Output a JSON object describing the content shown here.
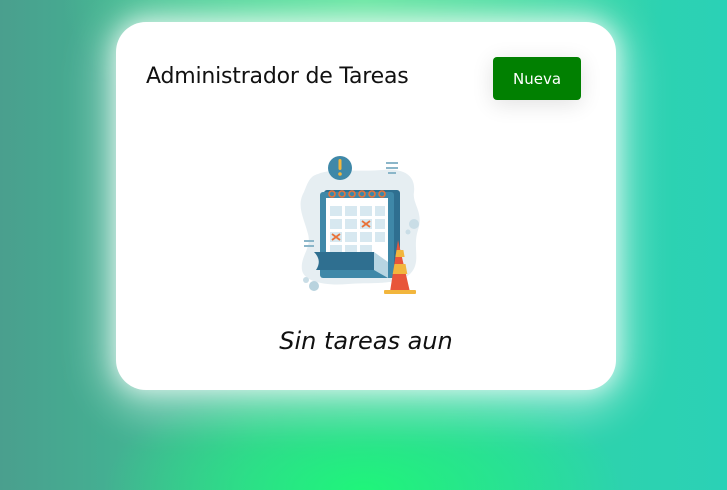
{
  "app": {
    "title": "Administrador de Tareas",
    "new_button_label": "Nueva"
  },
  "empty_state": {
    "message": "Sin tareas aun",
    "illustration_icon": "calendar-traffic-cone-icon"
  },
  "colors": {
    "button_background": "#018001",
    "button_text": "#ffffff",
    "card_background": "#ffffff"
  }
}
